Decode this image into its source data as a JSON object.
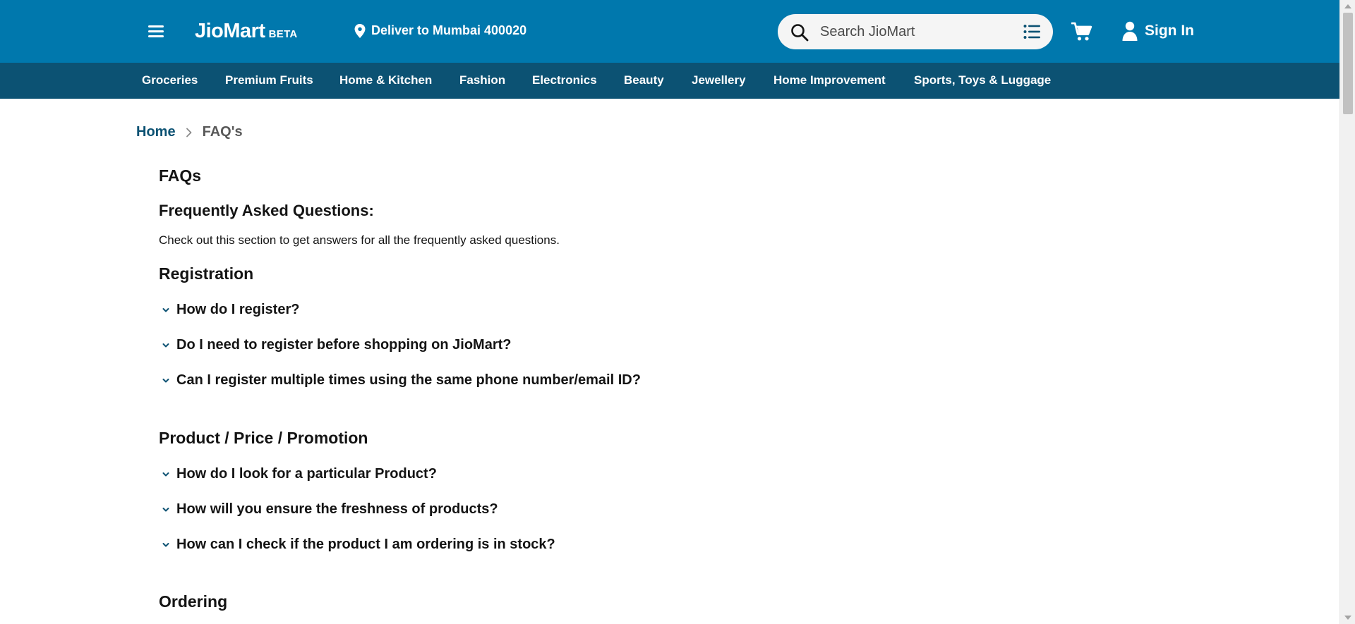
{
  "header": {
    "logo_text": "JioMart",
    "logo_badge": "BETA",
    "deliver_to": "Deliver to Mumbai 400020",
    "search_placeholder": "Search JioMart",
    "sign_in": "Sign In"
  },
  "categories": [
    "Groceries",
    "Premium Fruits",
    "Home & Kitchen",
    "Fashion",
    "Electronics",
    "Beauty",
    "Jewellery",
    "Home Improvement",
    "Sports, Toys & Luggage"
  ],
  "breadcrumb": {
    "home": "Home",
    "current": "FAQ's"
  },
  "page": {
    "title": "FAQs",
    "subtitle": "Frequently Asked Questions:",
    "intro": "Check out this section to get answers for all the frequently asked questions."
  },
  "sections": [
    {
      "title": "Registration",
      "questions": [
        "How do I register?",
        "Do I need to register before shopping on JioMart?",
        "Can I register multiple times using the same phone number/email ID?"
      ]
    },
    {
      "title": "Product / Price / Promotion",
      "questions": [
        "How do I look for a particular Product?",
        "How will you ensure the freshness of products?",
        "How can I check if the product I am ordering is in stock?"
      ]
    },
    {
      "title": "Ordering",
      "questions": []
    }
  ],
  "icons": {
    "menu": "hamburger-menu-icon",
    "location": "location-pin-icon",
    "search": "search-icon",
    "list": "list-icon",
    "cart": "cart-icon",
    "user": "user-icon",
    "breadcrumb_separator": "chevron-right-icon",
    "faq_toggle": "chevron-down-icon"
  },
  "colors": {
    "header_bg": "#0078ad",
    "nav_bg": "#0c5273",
    "link": "#0c5273",
    "text": "#141414"
  }
}
